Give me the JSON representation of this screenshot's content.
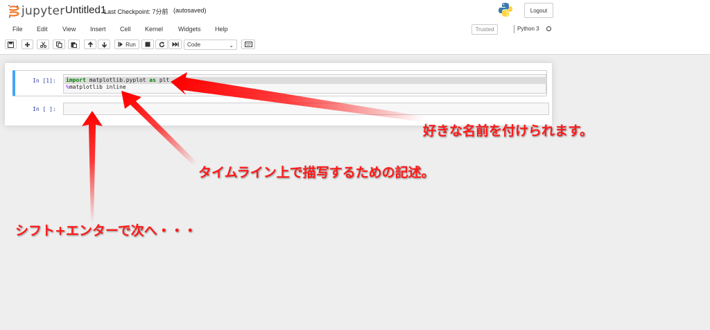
{
  "header": {
    "logo_text": "jupyter",
    "notebook_name": "Untitled1",
    "checkpoint": "Last Checkpoint: 7分前",
    "autosave": "(autosaved)",
    "logout_label": "Logout"
  },
  "menu": {
    "items": [
      "File",
      "Edit",
      "View",
      "Insert",
      "Cell",
      "Kernel",
      "Widgets",
      "Help"
    ],
    "trusted": "Trusted",
    "kernel": "Python 3"
  },
  "toolbar": {
    "run_label": "Run",
    "cell_type": "Code",
    "icons": [
      "save-icon",
      "plus-icon",
      "cut-icon",
      "copy-icon",
      "paste-icon",
      "arrow-up-icon",
      "arrow-down-icon",
      "run-icon",
      "stop-icon",
      "restart-icon",
      "fast-forward-icon",
      "keyboard-icon"
    ]
  },
  "cells": [
    {
      "prompt": "In [1]:",
      "lines": [
        {
          "keyword1": "import",
          "module": " matplotlib.pyplot ",
          "keyword2": "as",
          "alias": " plt"
        },
        {
          "magic": "%",
          "rest": "matplotlib inline"
        }
      ]
    },
    {
      "prompt": "In [ ]:",
      "lines": []
    }
  ],
  "annotations": {
    "name": "好きな名前を付けられます。",
    "inline": "タイムライン上で描写するための記述。",
    "shift": "シフト+エンターで次へ・・・"
  },
  "colors": {
    "accent": "#42a5f5",
    "annotation": "#ff1a1a",
    "prompt": "#303f9f",
    "keyword": "#008000",
    "magic": "#aa22ff"
  }
}
